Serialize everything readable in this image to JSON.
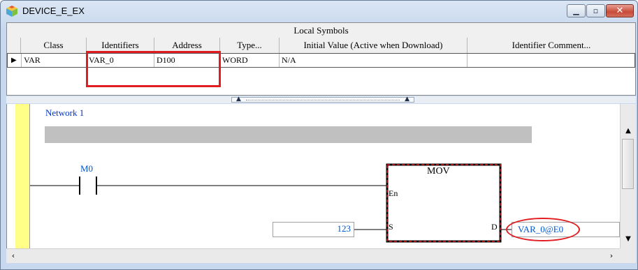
{
  "window": {
    "title": "DEVICE_E_EX"
  },
  "table": {
    "group_header": "Local Symbols",
    "columns": [
      "Class",
      "Identifiers",
      "Address",
      "Type...",
      "Initial Value (Active when Download)",
      "Identifier Comment..."
    ],
    "row": {
      "class": "VAR",
      "identifier": "VAR_0",
      "address": "D100",
      "type": "WORD",
      "initial_value": "N/A",
      "comment": ""
    },
    "row_indicator": "▶"
  },
  "diagram": {
    "network_label": "Network 1",
    "contact_label": "M0",
    "block": {
      "name": "MOV",
      "en_pin": "En",
      "s_pin": "S",
      "d_pin": "D"
    },
    "s_value": "123",
    "d_value": "VAR_0@E0"
  },
  "colors": {
    "highlight": "#e21d22",
    "operand": "#0055cc",
    "rail": "#ffff88"
  }
}
